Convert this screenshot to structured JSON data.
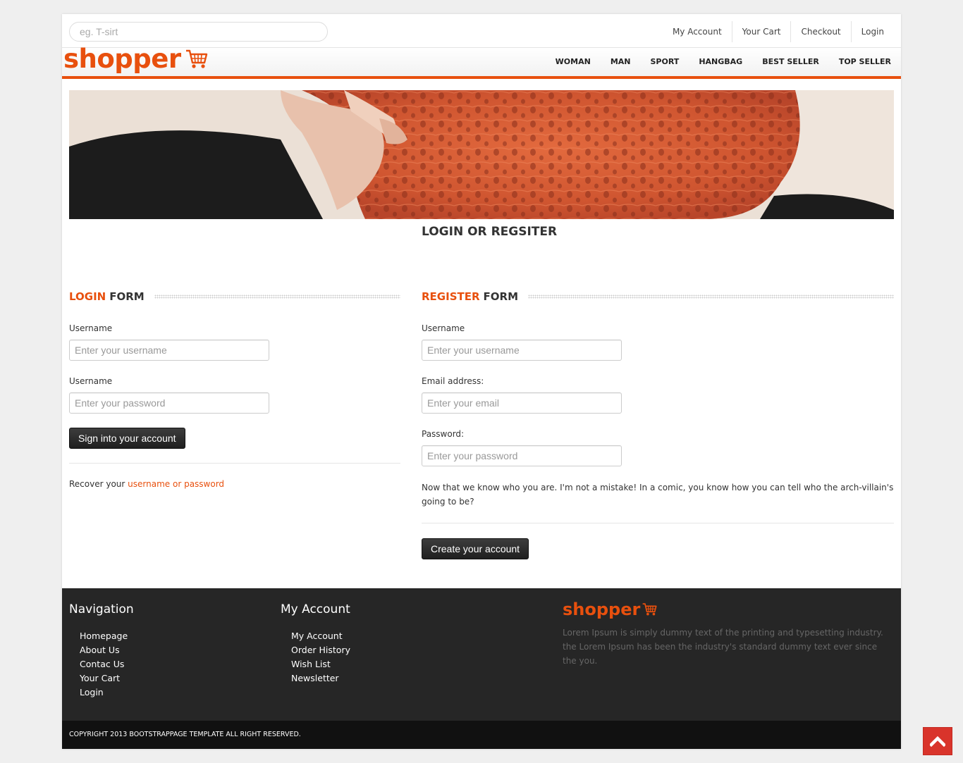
{
  "search": {
    "placeholder": "eg. T-sirt"
  },
  "top_links": [
    "My Account",
    "Your Cart",
    "Checkout",
    "Login"
  ],
  "logo": {
    "text": "shopper"
  },
  "main_nav": [
    "WOMAN",
    "MAN",
    "SPORT",
    "HANGBAG",
    "BEST SELLER",
    "TOP SELLER"
  ],
  "page_title": "LOGIN OR REGSITER",
  "login_form": {
    "heading_accent": "LOGIN",
    "heading_rest": "FORM",
    "username_label": "Username",
    "username_placeholder": "Enter your username",
    "password_label": "Username",
    "password_placeholder": "Enter your password",
    "submit_label": "Sign into your account",
    "recover_prefix": "Recover your",
    "recover_link": "username or password"
  },
  "register_form": {
    "heading_accent": "REGISTER",
    "heading_rest": "FORM",
    "username_label": "Username",
    "username_placeholder": "Enter your username",
    "email_label": "Email address:",
    "email_placeholder": "Enter your email",
    "password_label": "Password:",
    "password_placeholder": "Enter your password",
    "text": "Now that we know who you are. I'm not a mistake! In a comic, you know how you can tell who the arch-villain's going to be?",
    "submit_label": "Create your account"
  },
  "footer": {
    "nav_title": "Navigation",
    "nav_links": [
      "Homepage",
      "About Us",
      "Contac Us",
      "Your Cart",
      "Login"
    ],
    "account_title": "My Account",
    "account_links": [
      "My Account",
      "Order History",
      "Wish List",
      "Newsletter"
    ],
    "logo_text": "shopper",
    "description": "Lorem Ipsum is simply dummy text of the printing and typesetting industry. the Lorem Ipsum has been the industry's standard dummy text ever since the you.",
    "copyright": "COPYRIGHT 2013 BOOTSTRAPPAGE TEMPLATE ALL RIGHT RESERVED."
  },
  "colors": {
    "accent": "#e8500e",
    "footer_bg": "#262626",
    "copyright_bg": "#111111",
    "back_to_top": "#d9342b"
  },
  "icons": {
    "cart": "shopping-cart-icon",
    "back_to_top": "chevron-up-icon"
  }
}
